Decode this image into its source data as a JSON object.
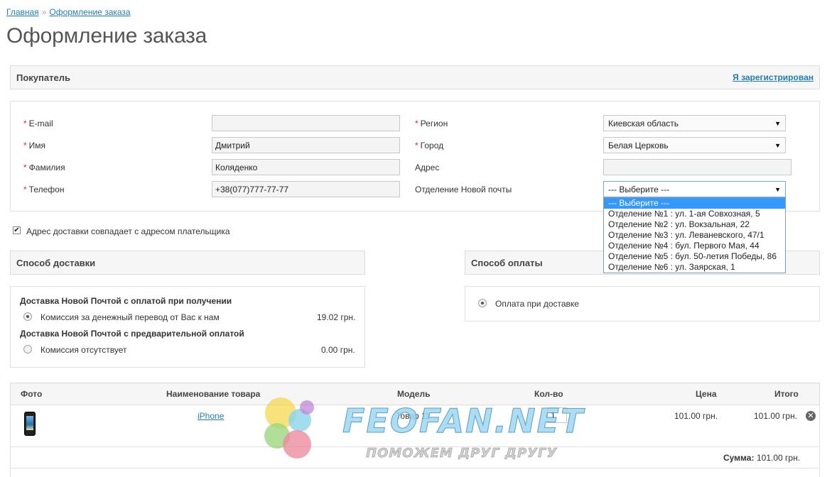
{
  "breadcrumb": {
    "home": "Главная",
    "separator": "»",
    "current": "Оформление заказа"
  },
  "page_title": "Оформление заказа",
  "buyer": {
    "title": "Покупатель",
    "registered_link": "Я зарегистрирован",
    "fields": {
      "email": {
        "label": "E-mail",
        "value": ""
      },
      "name": {
        "label": "Имя",
        "value": "Дмитрий"
      },
      "surname": {
        "label": "Фамилия",
        "value": "Коляденко"
      },
      "phone": {
        "label": "Телефон",
        "value": "+38(077)777-77-77"
      },
      "region": {
        "label": "Регион",
        "value": "Киевская область"
      },
      "city": {
        "label": "Город",
        "value": "Белая Церковь"
      },
      "address": {
        "label": "Адрес",
        "value": ""
      },
      "np_branch": {
        "label": "Отделение Новой почты",
        "value": "--- Выберите ---"
      }
    },
    "required_mark": "*",
    "np_options": [
      "--- Выберите ---",
      "Отделение №1 : ул. 1-ая Совхозная, 5",
      "Отделение №2 : ул. Вокзальная, 22",
      "Отделение №3 : ул. Леваневского, 47/1",
      "Отделение №4 : бул. Первого Мая, 44",
      "Отделение №5 : бул. 50-летия Победы, 86",
      "Отделение №6 : ул. Заярская, 1"
    ]
  },
  "same_address": {
    "label": "Адрес доставки совпадает с адресом плательщика",
    "checked": true
  },
  "delivery": {
    "title": "Способ доставки",
    "group1_title": "Доставка Новой Почтой с оплатой при получении",
    "option1_label": "Комиссия за денежный перевод от Вас к нам",
    "option1_price": "19.02 грн.",
    "group2_title": "Доставка Новой Почтой с предварительной оплатой",
    "option2_label": "Комиссия отсутствует",
    "option2_price": "0.00 грн."
  },
  "payment": {
    "title": "Способ оплаты",
    "option_label": "Оплата при доставке"
  },
  "cart": {
    "headers": {
      "photo": "Фото",
      "name": "Наименование товара",
      "model": "Модель",
      "qty": "Кол-во",
      "price": "Цена",
      "total": "Итого"
    },
    "rows": [
      {
        "name": "iPhone",
        "model": "Товар 11",
        "qty": "1",
        "price": "101.00 грн.",
        "total": "101.00 грн."
      }
    ],
    "sum_label": "Сумма:",
    "sum_value": "101.00 грн."
  },
  "watermark": {
    "title": "FEOFAN.NET",
    "subtitle": "ПОМОЖЕМ ДРУГ ДРУГУ"
  },
  "colors": {
    "link": "#1f7fb3",
    "required": "#ee2222",
    "dropdown_selected": "#3399ff",
    "header_bg": "#f6f6f6"
  },
  "icons": {
    "remove": "close-circle-icon",
    "checkbox": "check-icon",
    "product": "iphone-thumbnail"
  }
}
